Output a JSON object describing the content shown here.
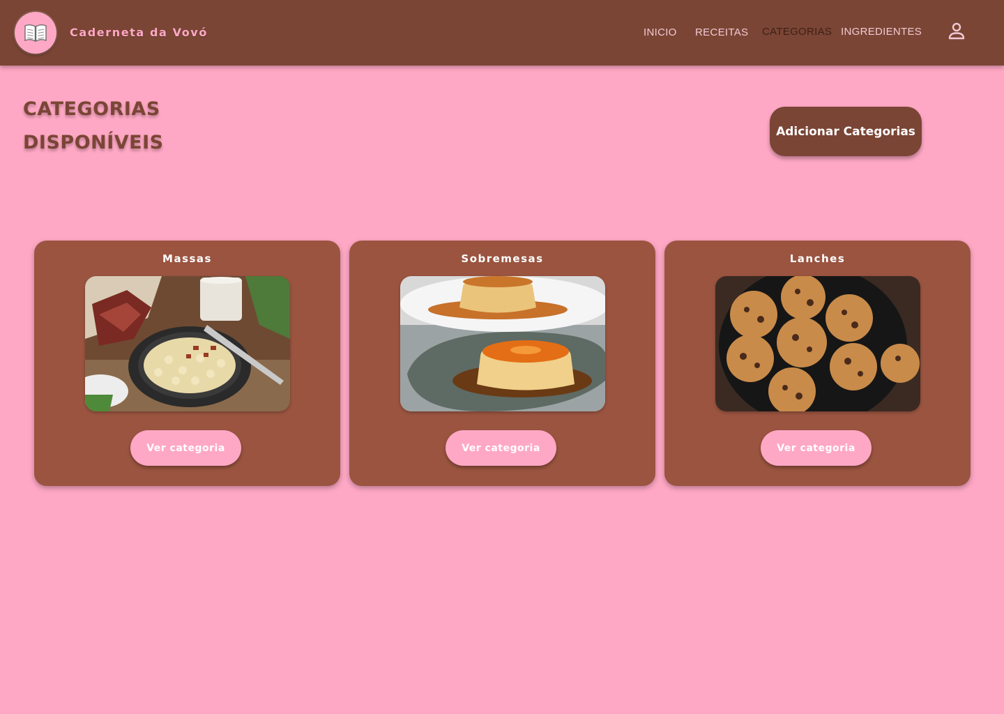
{
  "header": {
    "brand": "Caderneta da Vovó",
    "logo_icon": "open-book-icon",
    "nav": [
      {
        "label": "INICIO",
        "active": false
      },
      {
        "label": "RECEITAS",
        "active": false
      },
      {
        "label": "CATEGORIAS",
        "active": true
      },
      {
        "label": "INGREDIENTES",
        "active": false
      }
    ],
    "user_icon": "person-icon"
  },
  "main": {
    "title_line1": "CATEGORIAS",
    "title_line2": "DISPONÍVEIS",
    "add_button": "Adicionar Categorias"
  },
  "categories": [
    {
      "name": "Massas",
      "button": "Ver categoria",
      "image": "pasta-dish-photo"
    },
    {
      "name": "Sobremesas",
      "button": "Ver categoria",
      "image": "flan-pudding-photo"
    },
    {
      "name": "Lanches",
      "button": "Ver categoria",
      "image": "cookies-photo"
    }
  ],
  "colors": {
    "background": "#FFA8C5",
    "header": "#7A4535",
    "card": "#9A5440",
    "accent_pink": "#FFA8C5"
  }
}
